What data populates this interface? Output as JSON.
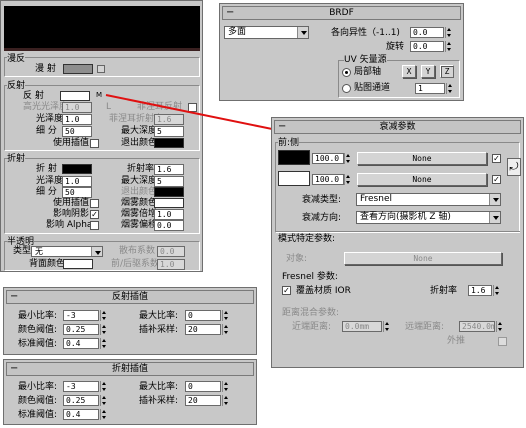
{
  "mat": {
    "section_title": "漫反",
    "diffuse_label": "漫 射",
    "reflect_title": "反射",
    "refl": {
      "reflect": "反 射",
      "m_btn": "M",
      "gloss_high": "高光光泽度",
      "gloss_high_val": "1.0",
      "l_btn": "L",
      "fresnel": "菲涅耳反射",
      "gloss": "光泽度",
      "gloss_val": "1.0",
      "fresnel_ior": "菲涅耳折射率",
      "fresnel_ior_val": "1.6",
      "subdiv": "细 分",
      "subdiv_val": "50",
      "max_depth": "最大深度",
      "max_depth_val": "5",
      "use_interp": "使用插值",
      "exit_color": "退出颜色"
    },
    "refract_title": "折射",
    "refr": {
      "refract": "折 射",
      "ior": "折射率",
      "ior_val": "1.6",
      "gloss": "光泽度",
      "gloss_val": "1.0",
      "max_depth": "最大深度",
      "max_depth_val": "5",
      "subdiv": "细 分",
      "subdiv_val": "50",
      "exit_color": "退出颜色",
      "use_interp": "使用插值",
      "fog_color": "烟雾颜色",
      "affect_shadows": "影响阴影",
      "fog_mult": "烟雾倍增",
      "fog_mult_val": "1.0",
      "affect_alpha": "影响 Alpha",
      "fog_bias": "烟雾偏移",
      "fog_bias_val": "0.0"
    },
    "translucency_title": "半透明",
    "trans": {
      "type": "类型",
      "type_val": "无",
      "scatter": "散布系数",
      "scatter_val": "0.0",
      "back_color": "背面颜色",
      "fb": "前/后驱系数",
      "fb_val": "1.0"
    }
  },
  "brdf": {
    "title": "BRDF",
    "type": "多面",
    "aniso": "各向异性（-1..1)",
    "aniso_val": "0.0",
    "rotation": "旋转",
    "rotation_val": "0.0",
    "uv_group": "UV 矢量源",
    "local_axis": "局部轴",
    "x": "X",
    "y": "Y",
    "z": "Z",
    "map_channel": "贴图通道",
    "channel_val": "1"
  },
  "falloff": {
    "title": "衰减参数",
    "front_side": "前:侧",
    "val1": "100.0",
    "none1": "None",
    "val2": "100.0",
    "none2": "None",
    "type_label": "衰减类型:",
    "type_val": "Fresnel",
    "dir_label": "衰减方向:",
    "dir_val": "查看方向(摄影机 Z 轴)",
    "mode_title": "模式特定参数:",
    "object_label": "对象:",
    "object_val": "None",
    "fresnel_params": "Fresnel 参数:",
    "override_ior": "覆盖材质 IOR",
    "ior_label": "折射率",
    "ior_val": "1.6",
    "blend_title": "距离混合参数:",
    "near_label": "近端距离:",
    "near_val": "0.0mm",
    "far_label": "远端距离:",
    "far_val": "2540.0m",
    "extrapolate": "外推"
  },
  "refl_interp": {
    "title": "反射插值",
    "min_rate": "最小比率:",
    "min_val": "-3",
    "max_rate": "最大比率:",
    "max_val": "0",
    "color_thresh": "颜色阈值:",
    "color_val": "0.25",
    "interp_samples": "插补采样:",
    "samples_val": "20",
    "normal_thresh": "标准阈值:",
    "normal_val": "0.4"
  },
  "refr_interp": {
    "title": "折射插值",
    "min_rate": "最小比率:",
    "min_val": "-3",
    "max_rate": "最大比率:",
    "max_val": "0",
    "color_thresh": "颜色阈值:",
    "color_val": "0.25",
    "interp_samples": "插补采样:",
    "samples_val": "20",
    "normal_thresh": "标准阈值:",
    "normal_val": "0.4"
  }
}
